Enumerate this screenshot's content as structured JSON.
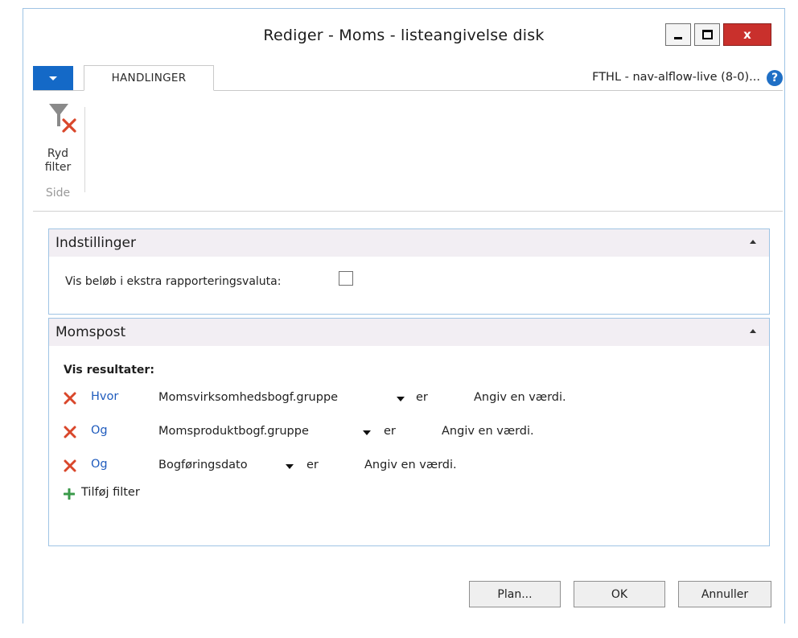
{
  "window": {
    "title": "Rediger - Moms - listeangivelse disk",
    "minimize": "minimize",
    "maximize": "maximize",
    "close_label": "x"
  },
  "ribbon": {
    "tab_label": "HANDLINGER",
    "company": "FTHL - nav-alflow-live (8-0)...",
    "help_label": "?",
    "clear_filter_label": "Ryd filter",
    "group_label": "Side"
  },
  "settings_panel": {
    "title": "Indstillinger",
    "option_label": "Vis beløb i ekstra rapporteringsvaluta:",
    "option_checked": false
  },
  "moms_panel": {
    "title": "Momspost",
    "results_label": "Vis resultater:",
    "filters": [
      {
        "conjunction": "Hvor",
        "field": "Momsvirksomhedsbogf.gruppe",
        "operator": "er",
        "value": "Angiv en værdi."
      },
      {
        "conjunction": "Og",
        "field": "Momsproduktbogf.gruppe",
        "operator": "er",
        "value": "Angiv en værdi."
      },
      {
        "conjunction": "Og",
        "field": "Bogføringsdato",
        "operator": "er",
        "value": "Angiv en værdi."
      }
    ],
    "add_filter_label": "Tilføj filter"
  },
  "buttons": {
    "plan": "Plan...",
    "ok": "OK",
    "cancel": "Annuller"
  },
  "colors": {
    "accent": "#1469c7",
    "link": "#1f5bbd",
    "remove_icon": "#d9472b",
    "add_icon": "#3a9a4a",
    "panel_border": "#9fc4e4",
    "panel_header": "#f2eef3"
  },
  "icons": {
    "app_menu": "chevron-down-icon",
    "clear_filter": "filter-clear-icon",
    "remove_filter": "close-icon",
    "add_filter": "plus-icon",
    "help": "help-icon",
    "collapse": "chevron-up-icon"
  }
}
